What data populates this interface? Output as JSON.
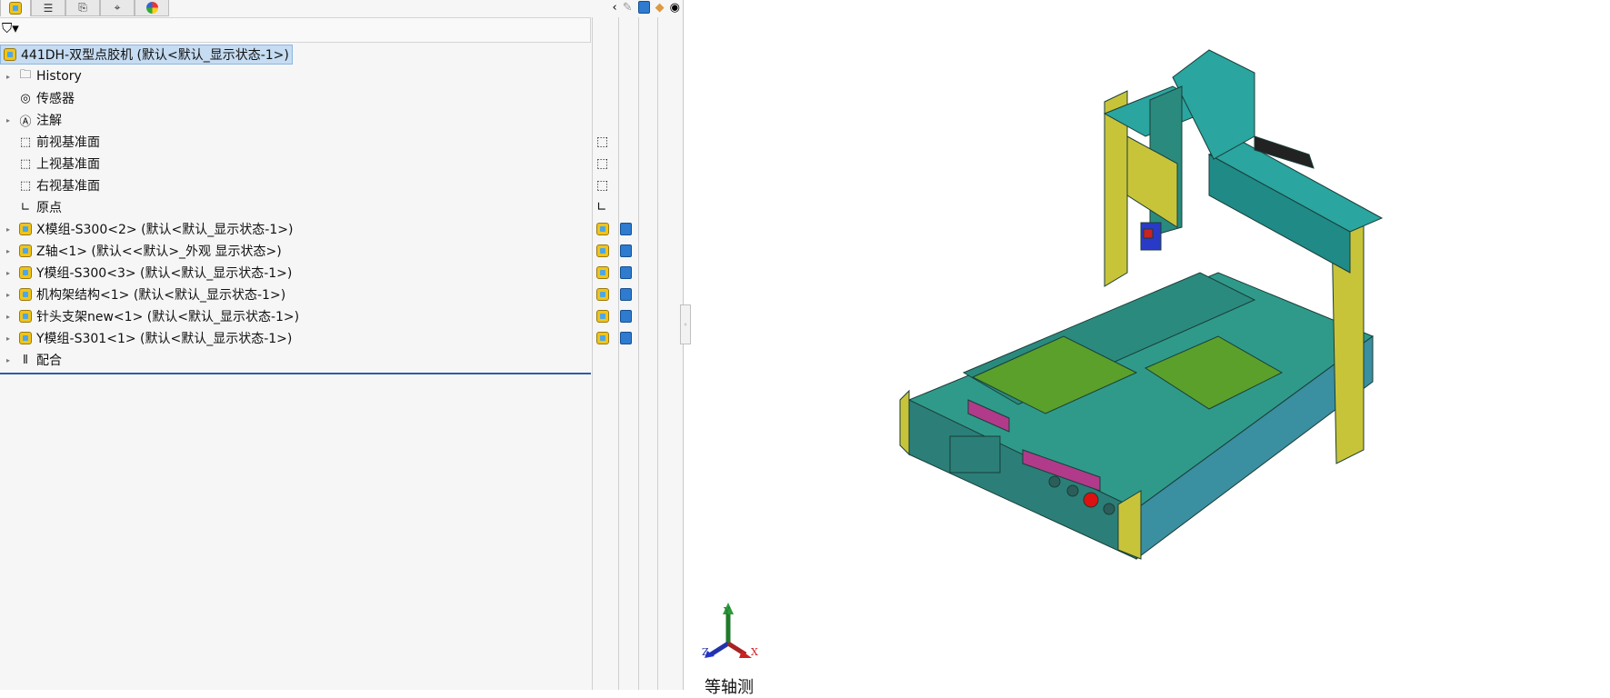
{
  "tabs": [
    {
      "name": "feature-manager",
      "icon": "assembly-icon"
    },
    {
      "name": "property-manager",
      "icon": "list-icon"
    },
    {
      "name": "configuration-manager",
      "icon": "config-icon"
    },
    {
      "name": "dimxpert",
      "icon": "crosshair-icon"
    },
    {
      "name": "display-manager",
      "icon": "appearance-icon"
    }
  ],
  "tree": {
    "root": "441DH-双型点胶机  (默认<默认_显示状态-1>)",
    "items": [
      {
        "label": "History",
        "icon": "history-folder-icon",
        "expand": true
      },
      {
        "label": "传感器",
        "icon": "sensor-icon",
        "expand": false
      },
      {
        "label": "注解",
        "icon": "annotation-icon",
        "expand": true
      },
      {
        "label": "前视基准面",
        "icon": "plane-icon",
        "expand": false,
        "side": "plane"
      },
      {
        "label": "上视基准面",
        "icon": "plane-icon",
        "expand": false,
        "side": "plane"
      },
      {
        "label": "右视基准面",
        "icon": "plane-icon",
        "expand": false,
        "side": "plane"
      },
      {
        "label": "原点",
        "icon": "origin-icon",
        "expand": false,
        "side": "origin"
      },
      {
        "label": "X模组-S300<2> (默认<默认_显示状态-1>)",
        "icon": "assembly-icon",
        "expand": true,
        "side": "asm"
      },
      {
        "label": "Z轴<1> (默认<<默认>_外观 显示状态>)",
        "icon": "assembly-icon",
        "expand": true,
        "side": "asm"
      },
      {
        "label": "Y模组-S300<3> (默认<默认_显示状态-1>)",
        "icon": "assembly-icon",
        "expand": true,
        "side": "asm"
      },
      {
        "label": "机构架结构<1> (默认<默认_显示状态-1>)",
        "icon": "assembly-icon",
        "expand": true,
        "side": "asm"
      },
      {
        "label": "针头支架new<1> (默认<默认_显示状态-1>)",
        "icon": "assembly-icon",
        "expand": true,
        "side": "asm"
      },
      {
        "label": "Y模组-S301<1> (默认<默认_显示状态-1>)",
        "icon": "assembly-icon",
        "expand": true,
        "side": "asm"
      },
      {
        "label": "配合",
        "icon": "mates-icon",
        "expand": true
      }
    ]
  },
  "view": {
    "orientation": "等轴测",
    "triad": {
      "x": "X",
      "y": "Y",
      "z": "Z"
    }
  },
  "colors": {
    "teal": "#2a8a7e",
    "yellow": "#c8c43a",
    "green": "#5aa02a",
    "selection": "#c5dcf2"
  }
}
